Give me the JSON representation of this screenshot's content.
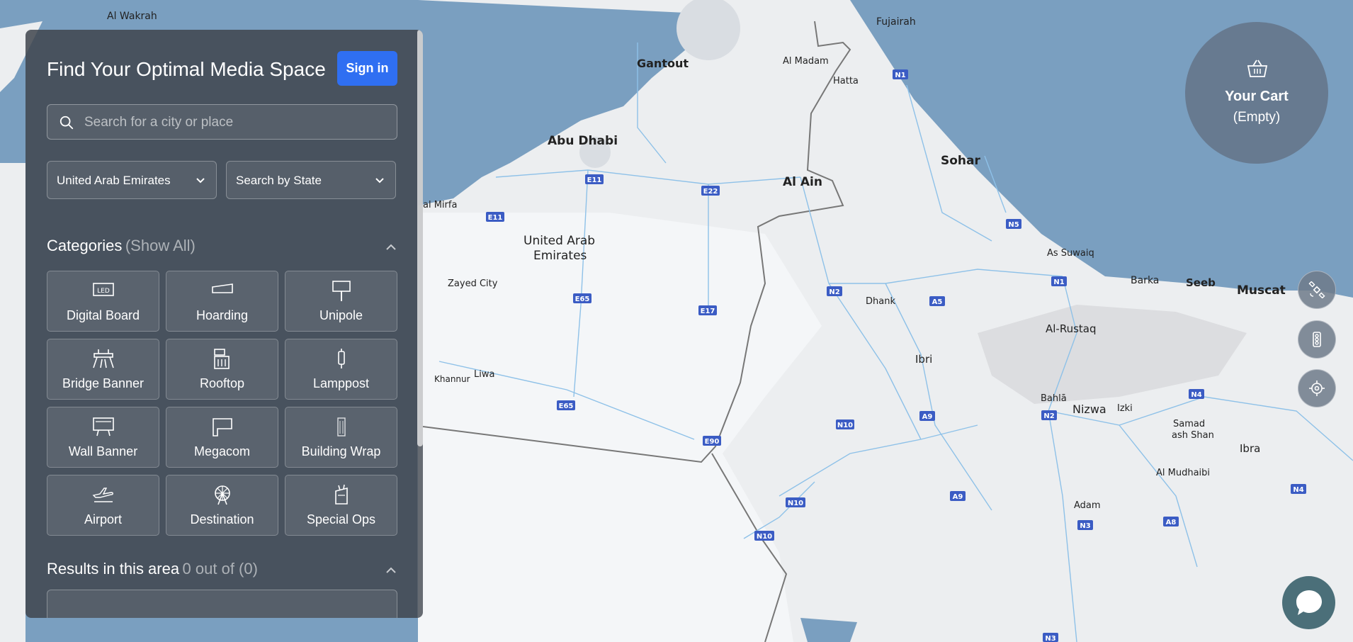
{
  "panel": {
    "title": "Find Your Optimal Media Space",
    "sign_in": "Sign in",
    "search_placeholder": "Search for a city or place",
    "country": "United Arab Emirates",
    "state": "Search by State"
  },
  "categories": {
    "title": "Categories",
    "show_all": "(Show All)",
    "items": [
      {
        "label": "Digital Board",
        "icon": "led-board-icon"
      },
      {
        "label": "Hoarding",
        "icon": "hoarding-icon"
      },
      {
        "label": "Unipole",
        "icon": "unipole-icon"
      },
      {
        "label": "Bridge Banner",
        "icon": "bridge-icon"
      },
      {
        "label": "Rooftop",
        "icon": "rooftop-icon"
      },
      {
        "label": "Lamppost",
        "icon": "lamppost-icon"
      },
      {
        "label": "Wall Banner",
        "icon": "wall-banner-icon"
      },
      {
        "label": "Megacom",
        "icon": "megacom-icon"
      },
      {
        "label": "Building Wrap",
        "icon": "building-wrap-icon"
      },
      {
        "label": "Airport",
        "icon": "airplane-icon"
      },
      {
        "label": "Destination",
        "icon": "ferris-wheel-icon"
      },
      {
        "label": "Special Ops",
        "icon": "special-ops-icon"
      }
    ]
  },
  "results": {
    "title": "Results in this area",
    "count": "0 out of (0)"
  },
  "cart": {
    "title": "Your Cart",
    "status": "(Empty)"
  },
  "map": {
    "places": [
      "Al Wakrah",
      "Fujairah",
      "Gantout",
      "Al Madam",
      "Hatta",
      "Abu Dhabi",
      "Sohar",
      "Al Ain",
      "al Mirfa",
      "United Arab",
      "Emirates",
      "As Suwaiq",
      "Zayed City",
      "Barka",
      "Seeb",
      "Muscat",
      "Dhank",
      "Al-Rustaq",
      "Ibri",
      "Khannur",
      "Liwa",
      "Bahlā",
      "Nizwa",
      "Izki",
      "Samad",
      "ash Shan",
      "Ibra",
      "Al Mudhaibi",
      "Adam"
    ],
    "roads": [
      "N1",
      "E11",
      "E22",
      "E11",
      "N5",
      "N1",
      "E65",
      "E17",
      "N2",
      "A5",
      "E65",
      "E90",
      "N10",
      "A9",
      "N2",
      "N4",
      "N10",
      "A9",
      "N10",
      "N3",
      "A8",
      "N4",
      "N3"
    ]
  }
}
